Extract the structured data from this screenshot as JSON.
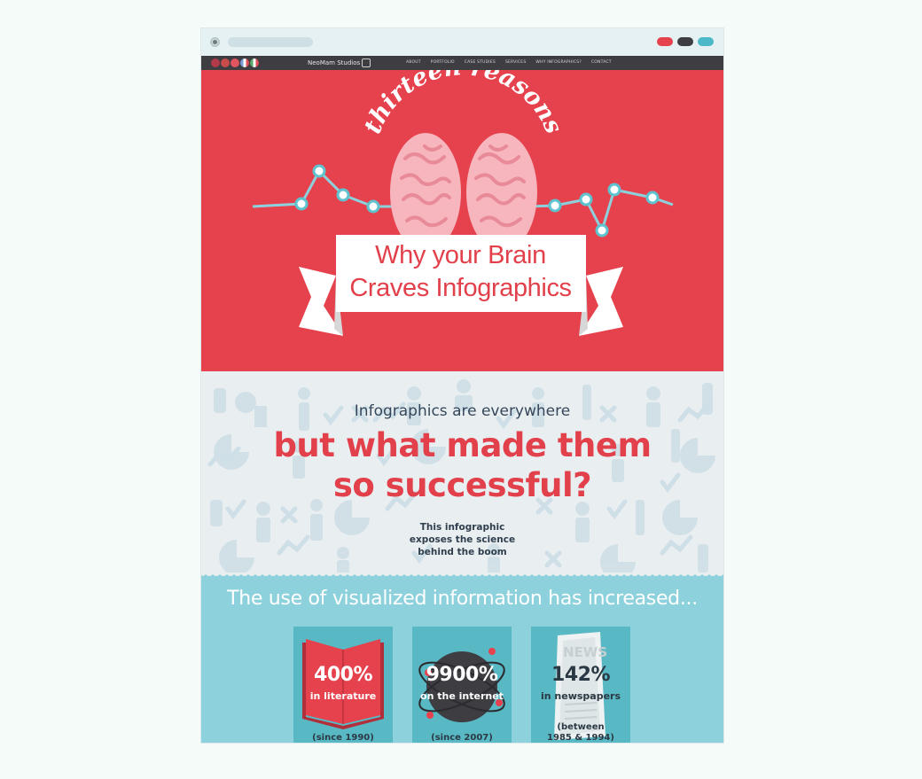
{
  "nav": {
    "brand": "NeoMam Studios",
    "links": [
      "ABOUT",
      "PORTFOLIO",
      "CASE STUDIES",
      "SERVICES",
      "WHY INFOGRAPHICS?",
      "CONTACT"
    ],
    "flag_icons": [
      "uk-flag-icon",
      "germany-flag-icon",
      "poland-flag-icon",
      "france-flag-icon",
      "italy-flag-icon"
    ]
  },
  "hero": {
    "arc_title": "thirteen reasons",
    "banner_line1": "Why your Brain",
    "banner_line2": "Craves Infographics"
  },
  "intro": {
    "line": "Infographics are everywhere",
    "headline1": "but what made them",
    "headline2": "so successful?",
    "sub1": "This infographic",
    "sub2": "exposes the science",
    "sub3": "behind the boom"
  },
  "stats": {
    "heading": "The use of visualized information has increased...",
    "cards": [
      {
        "value": "400%",
        "label": "in literature",
        "since": [
          "(since 1990)"
        ],
        "icon": "book-icon"
      },
      {
        "value": "9900%",
        "label": "on the internet",
        "since": [
          "(since 2007)"
        ],
        "icon": "globe-icon"
      },
      {
        "value": "142%",
        "label": "in newspapers",
        "since": [
          "(between",
          "1985 & 1994)"
        ],
        "icon": "newspaper-icon",
        "icon_text": "NEWS"
      }
    ]
  },
  "colors": {
    "hero_red": "#e6424d",
    "nav_dark": "#3d3d42",
    "teal": "#8dd1dc",
    "card_teal": "#58b9c5",
    "text_navy": "#35475a"
  }
}
